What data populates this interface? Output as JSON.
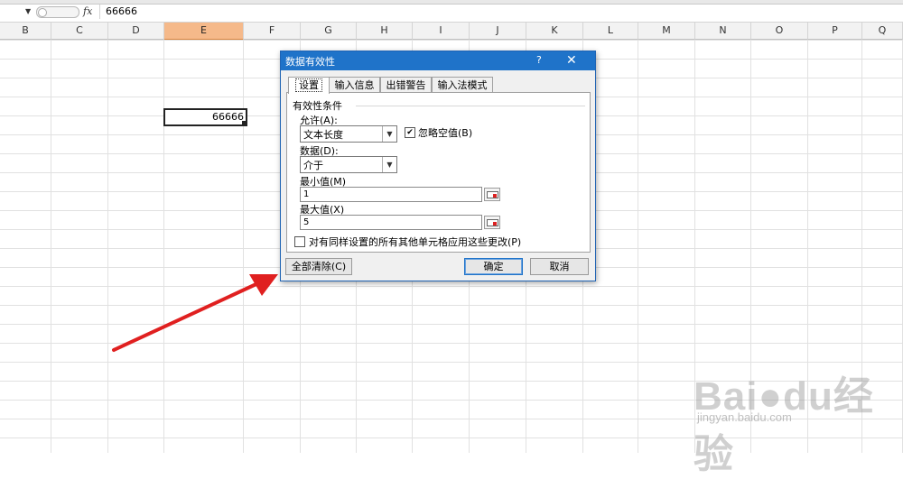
{
  "formula_bar": {
    "value": "66666",
    "fx_label": "fx"
  },
  "columns": [
    "B",
    "C",
    "D",
    "E",
    "F",
    "G",
    "H",
    "I",
    "J",
    "K",
    "L",
    "M",
    "N",
    "O",
    "P",
    "Q"
  ],
  "selected_column": "E",
  "active_cell": {
    "value": "66666"
  },
  "dialog": {
    "title": "数据有效性",
    "help_glyph": "?",
    "close_glyph": "✕",
    "tabs": [
      "设置",
      "输入信息",
      "出错警告",
      "输入法模式"
    ],
    "active_tab": "设置",
    "group_label": "有效性条件",
    "allow_label": "允许(A):",
    "allow_value": "文本长度",
    "ignore_blank_label": "忽略空值(B)",
    "ignore_blank_checked": true,
    "data_label": "数据(D):",
    "data_value": "介于",
    "min_label": "最小值(M)",
    "min_value": "1",
    "max_label": "最大值(X)",
    "max_value": "5",
    "apply_all_label": "对有同样设置的所有其他单元格应用这些更改(P)",
    "apply_all_checked": false,
    "clear_all_button": "全部清除(C)",
    "ok_button": "确定",
    "cancel_button": "取消"
  },
  "annotation_arrow": {
    "color": "#e02020"
  },
  "watermark": {
    "text": "Bai",
    "text2": "du",
    "text3": "经验",
    "url": "jingyan.baidu.com"
  }
}
